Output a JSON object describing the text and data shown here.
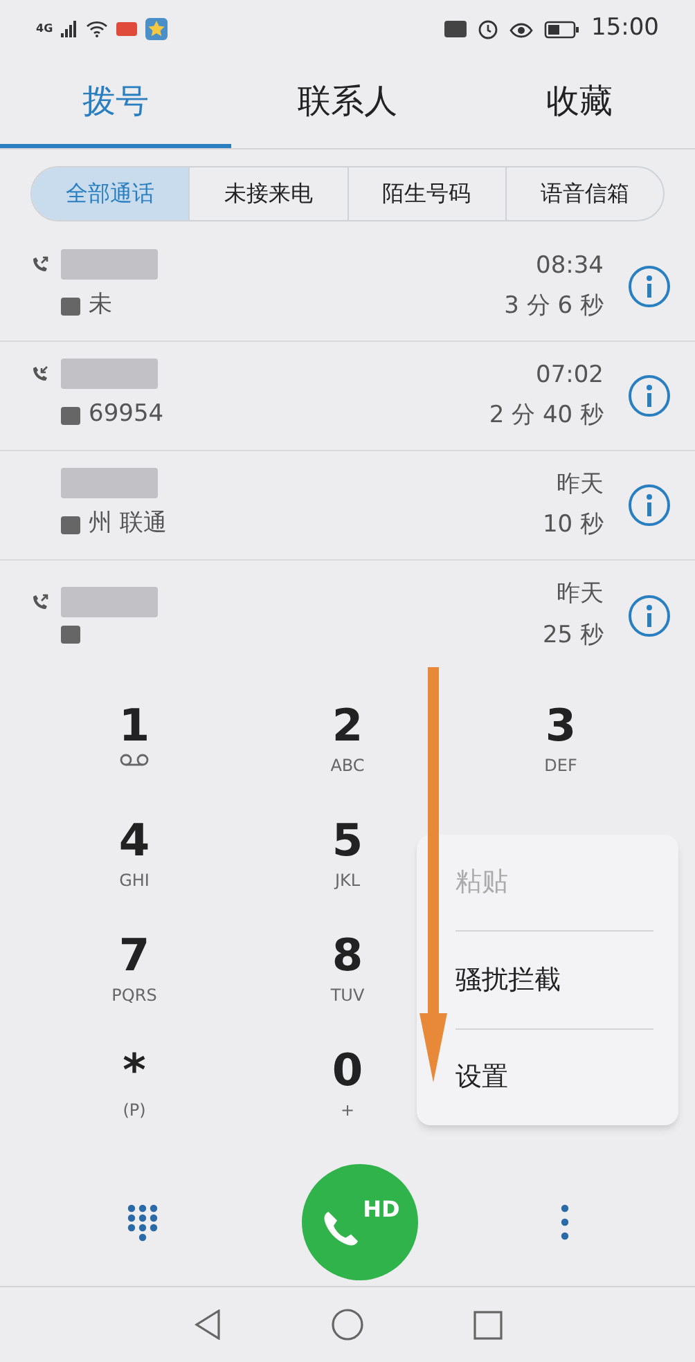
{
  "status_bar": {
    "network": "4G",
    "time": "15:00"
  },
  "tabs": [
    {
      "label": "拨号",
      "selected": true
    },
    {
      "label": "联系人",
      "selected": false
    },
    {
      "label": "收藏",
      "selected": false
    }
  ],
  "filters": [
    {
      "label": "全部通话",
      "selected": true
    },
    {
      "label": "未接来电",
      "selected": false
    },
    {
      "label": "陌生号码",
      "selected": false
    },
    {
      "label": "语音信箱",
      "selected": false
    }
  ],
  "calls": [
    {
      "kind": "outgoing",
      "detail": "未",
      "time": "08:34",
      "duration": "3 分 6 秒"
    },
    {
      "kind": "incoming",
      "detail": "69954",
      "time": "07:02",
      "duration": "2 分 40 秒"
    },
    {
      "kind": "unmarked",
      "detail": "州 联通",
      "time": "昨天",
      "duration": "10 秒"
    },
    {
      "kind": "outgoing",
      "time": "昨天",
      "duration": "25 秒"
    }
  ],
  "keypad": [
    {
      "digit": "1",
      "kind": "voicemail"
    },
    {
      "digit": "2",
      "letters": "ABC",
      "kind": "letters"
    },
    {
      "digit": "3",
      "letters": "DEF",
      "kind": "letters"
    },
    {
      "digit": "4",
      "letters": "GHI",
      "kind": "letters"
    },
    {
      "digit": "5",
      "letters": "JKL",
      "kind": "letters"
    },
    {
      "kind": "hidden"
    },
    {
      "digit": "7",
      "letters": "PQRS",
      "kind": "letters"
    },
    {
      "digit": "8",
      "letters": "TUV",
      "kind": "letters"
    },
    {
      "kind": "hidden"
    },
    {
      "digit": "*",
      "letters": "(P)",
      "kind": "letters"
    },
    {
      "digit": "0",
      "letters": "+",
      "kind": "letters"
    },
    {
      "kind": "hidden"
    }
  ],
  "menu": [
    {
      "label": "粘贴",
      "disabled": true
    },
    {
      "label": "骚扰拦截",
      "disabled": false
    },
    {
      "label": "设置",
      "disabled": false
    }
  ],
  "call_button": {
    "label": "HD"
  }
}
